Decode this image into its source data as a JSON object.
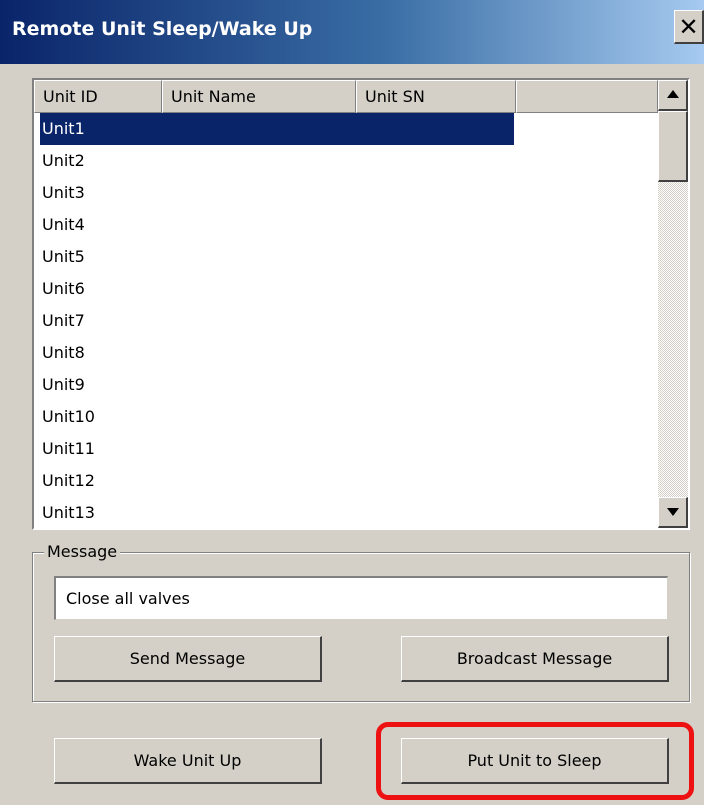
{
  "window": {
    "title": "Remote Unit Sleep/Wake Up",
    "close_glyph": "✕"
  },
  "list": {
    "columns": [
      "Unit ID",
      "Unit Name",
      "Unit SN",
      ""
    ],
    "rows": [
      "Unit1",
      "Unit2",
      "Unit3",
      "Unit4",
      "Unit5",
      "Unit6",
      "Unit7",
      "Unit8",
      "Unit9",
      "Unit10",
      "Unit11",
      "Unit12",
      "Unit13"
    ],
    "selected_index": 0
  },
  "message_group": {
    "label": "Message",
    "input_value": "Close all valves",
    "send_label": "Send Message",
    "broadcast_label": "Broadcast Message"
  },
  "actions": {
    "wake_label": "Wake Unit Up",
    "sleep_label": "Put Unit to Sleep"
  },
  "colors": {
    "selection": "#0a246a",
    "highlight": "#e11111",
    "face": "#d4d0c8"
  }
}
